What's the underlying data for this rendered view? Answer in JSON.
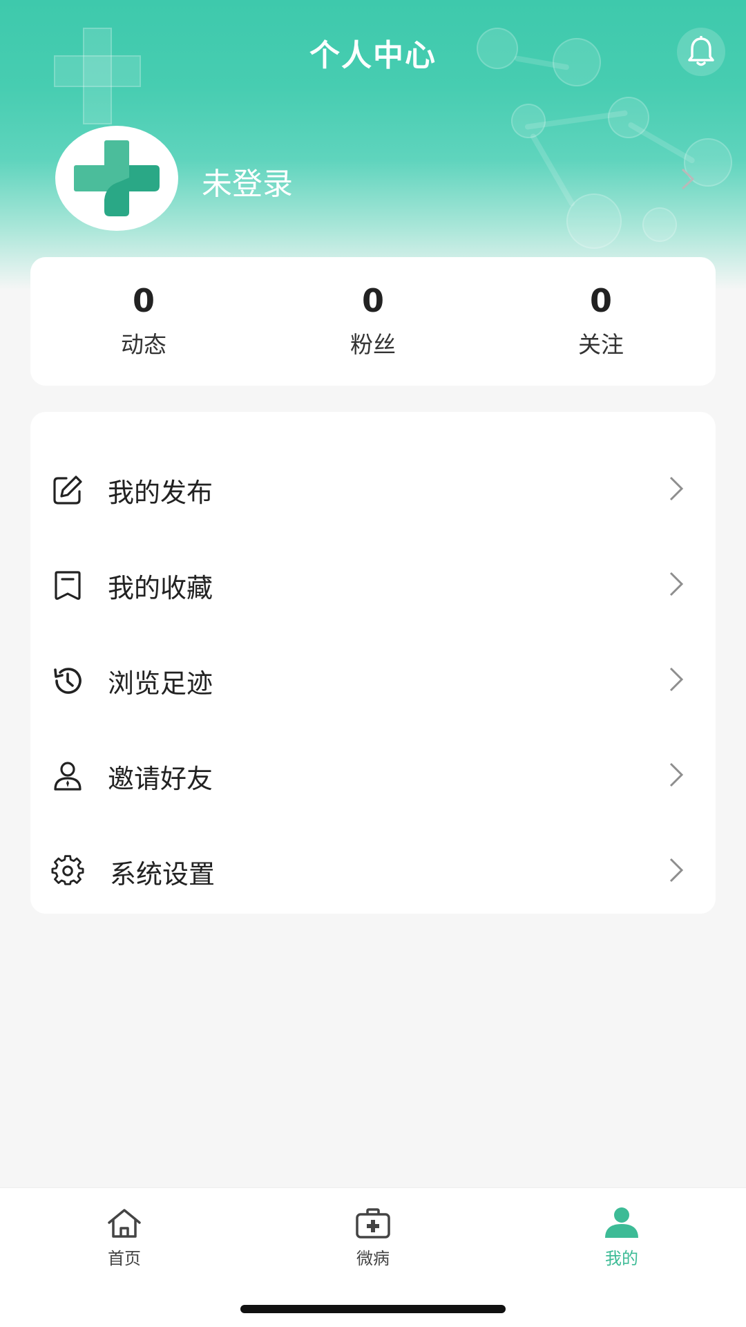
{
  "header": {
    "title": "个人中心",
    "bell_icon": "bell-icon"
  },
  "profile": {
    "username": "未登录",
    "avatar_icon": "medical-cross-logo",
    "chevron_icon": "chevron-right-icon"
  },
  "stats": [
    {
      "value": "0",
      "label": "动态"
    },
    {
      "value": "0",
      "label": "粉丝"
    },
    {
      "value": "0",
      "label": "关注"
    }
  ],
  "menu": [
    {
      "label": "我的发布",
      "icon": "edit-icon"
    },
    {
      "label": "我的收藏",
      "icon": "bookmark-icon"
    },
    {
      "label": "浏览足迹",
      "icon": "history-icon"
    },
    {
      "label": "邀请好友",
      "icon": "user-icon"
    },
    {
      "label": "系统设置",
      "icon": "gear-icon"
    }
  ],
  "tabbar": {
    "tabs": [
      {
        "label": "首页",
        "icon": "home-icon",
        "active": false
      },
      {
        "label": "微病",
        "icon": "medical-kit-icon",
        "active": false
      },
      {
        "label": "我的",
        "icon": "person-icon",
        "active": true
      }
    ]
  },
  "colors": {
    "accent": "#3dbb96",
    "header_teal": "#47cdb1",
    "background": "#f6f6f6"
  }
}
